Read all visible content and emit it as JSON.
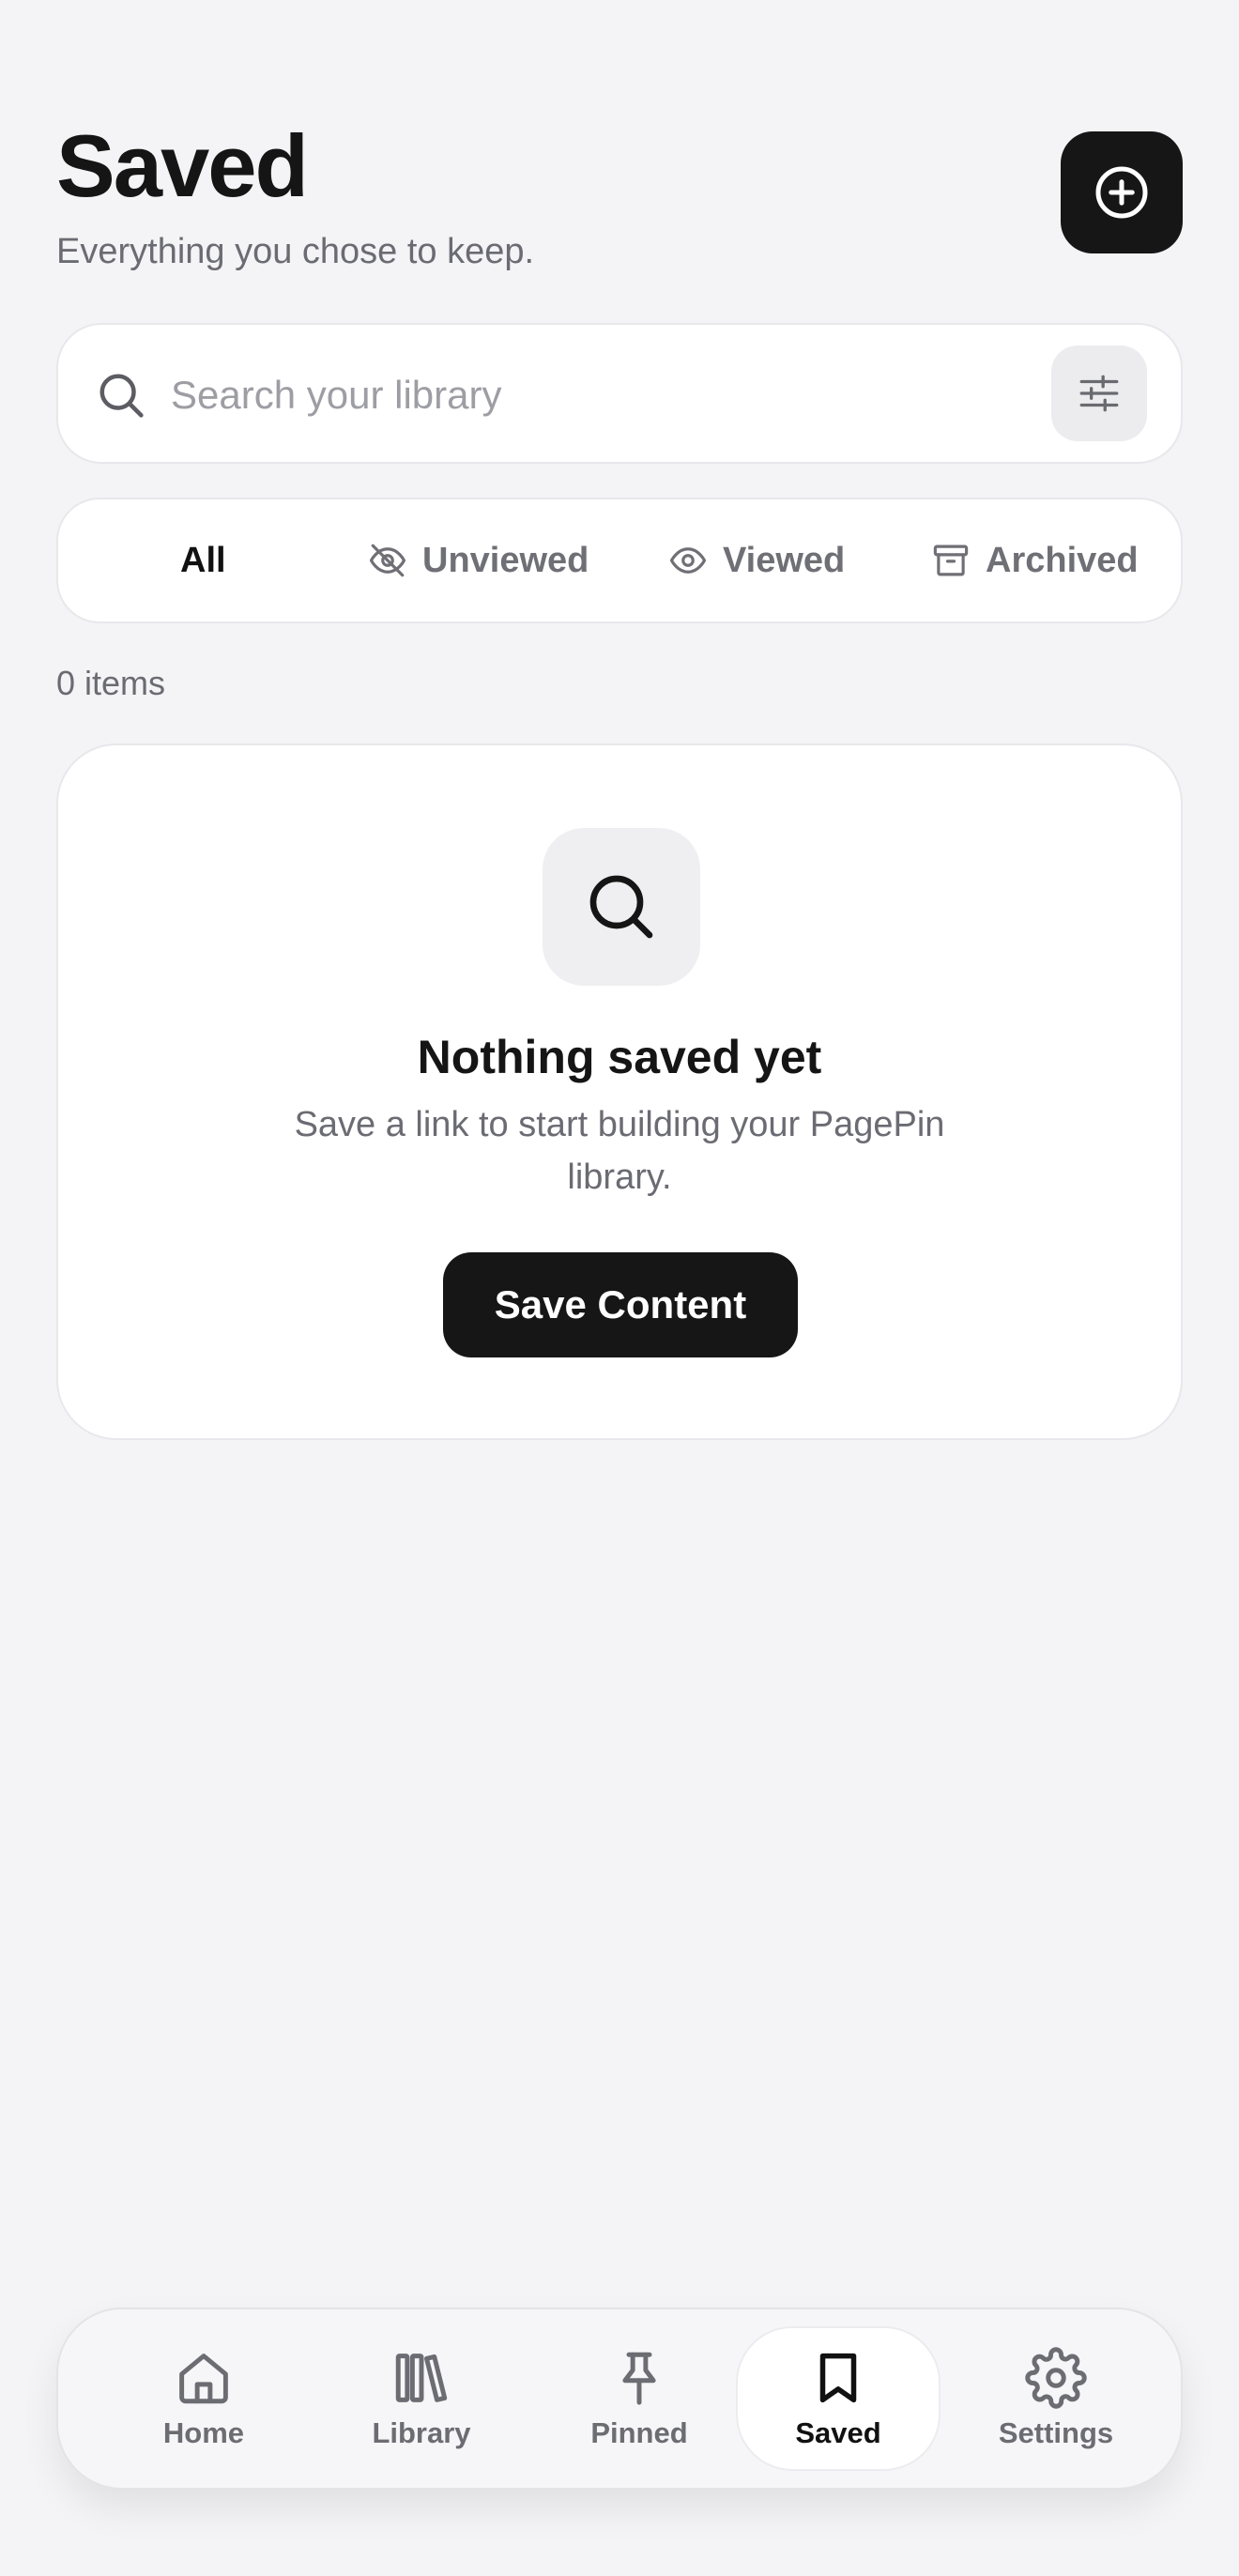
{
  "header": {
    "title": "Saved",
    "subtitle": "Everything you chose to keep.",
    "add_icon": "plus-circle-icon"
  },
  "search": {
    "placeholder": "Search your library",
    "value": "",
    "icon": "search-icon",
    "filter_icon": "sliders-icon"
  },
  "tabs": [
    {
      "label": "All",
      "icon": "",
      "active": true
    },
    {
      "label": "Unviewed",
      "icon": "eye-off-icon",
      "active": false
    },
    {
      "label": "Viewed",
      "icon": "eye-icon",
      "active": false
    },
    {
      "label": "Archived",
      "icon": "archive-icon",
      "active": false
    }
  ],
  "count_label": "0 items",
  "empty_state": {
    "icon": "search-icon",
    "title": "Nothing saved yet",
    "description": "Save a link to start building your PagePin library.",
    "button_label": "Save Content"
  },
  "nav": [
    {
      "label": "Home",
      "icon": "home-icon",
      "active": false
    },
    {
      "label": "Library",
      "icon": "library-icon",
      "active": false
    },
    {
      "label": "Pinned",
      "icon": "pin-icon",
      "active": false
    },
    {
      "label": "Saved",
      "icon": "bookmark-icon",
      "active": true
    },
    {
      "label": "Settings",
      "icon": "gear-icon",
      "active": false
    }
  ],
  "colors": {
    "background": "#f4f4f6",
    "primary": "#161616",
    "muted_text": "#6b6b73",
    "card": "#ffffff"
  }
}
